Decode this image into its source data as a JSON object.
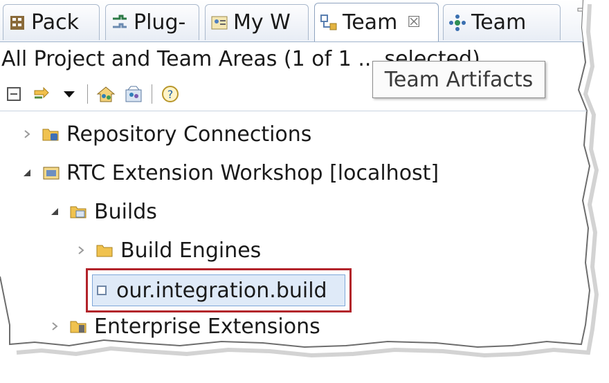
{
  "tabs": [
    {
      "label": "Pack",
      "icon": "package-explorer-icon"
    },
    {
      "label": "Plug-",
      "icon": "plugins-icon"
    },
    {
      "label": "My W",
      "icon": "my-work-icon"
    },
    {
      "label": "Team",
      "icon": "team-artifacts-icon",
      "active": true,
      "close": "☒"
    },
    {
      "label": "Team",
      "icon": "team-organization-icon"
    }
  ],
  "header": {
    "title": "All Project and Team Areas (1 of 1 ... selected)"
  },
  "tooltip": {
    "text": "Team Artifacts"
  },
  "toolbar": {
    "buttons": [
      "collapse-all-icon",
      "link-with-editor-icon",
      "view-menu-dropdown-icon",
      "manage-project-area-icon",
      "manage-team-area-icon",
      "help-icon"
    ]
  },
  "tree": {
    "items": [
      {
        "label": "Repository Connections",
        "icon": "repository-connections-icon",
        "expanded": false
      },
      {
        "label": "RTC Extension Workshop [localhost]",
        "icon": "project-area-icon",
        "expanded": true
      },
      {
        "label": "Builds",
        "icon": "builds-folder-icon",
        "expanded": true
      },
      {
        "label": "Build Engines",
        "icon": "folder-icon",
        "expanded": false
      },
      {
        "label": "our.integration.build",
        "icon": "build-definition-icon",
        "selected": true
      },
      {
        "label": "Enterprise Extensions",
        "icon": "enterprise-extensions-icon",
        "expanded": false
      }
    ]
  },
  "colors": {
    "selection_outline": "#b2232a",
    "selection_fill": "#dfeaf8",
    "folder": "#e8b94a"
  }
}
